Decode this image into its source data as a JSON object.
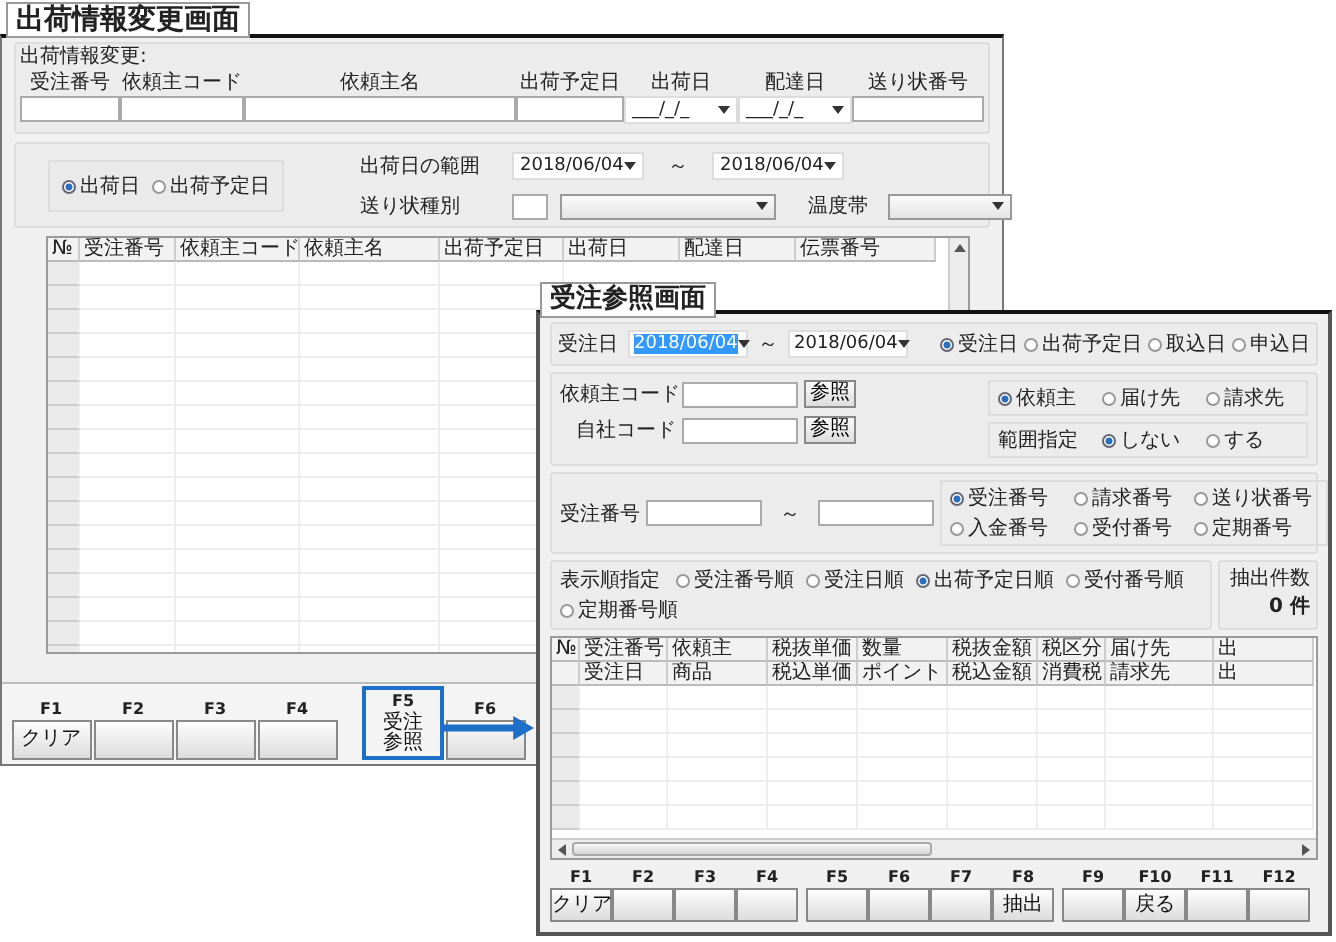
{
  "shipping_screen": {
    "title": "出荷情報変更画面",
    "group_label": "出荷情報変更:",
    "fields": [
      {
        "label": "受注番号",
        "kind": "text"
      },
      {
        "label": "依頼主コード",
        "kind": "text"
      },
      {
        "label": "依頼主名",
        "kind": "text"
      },
      {
        "label": "出荷予定日",
        "kind": "text"
      },
      {
        "label": "出荷日",
        "kind": "date",
        "value": "___/_/_"
      },
      {
        "label": "配達日",
        "kind": "date",
        "value": "___/_/_"
      },
      {
        "label": "送り状番号",
        "kind": "text"
      }
    ],
    "date_basis": [
      {
        "label": "出荷日",
        "selected": true
      },
      {
        "label": "出荷予定日",
        "selected": false
      }
    ],
    "range": {
      "label": "出荷日の範囲",
      "from": "2018/06/04",
      "separator": "～",
      "to": "2018/06/04"
    },
    "invoice_type_label": "送り状種別",
    "temperature_label": "温度帯",
    "table": {
      "columns": [
        "№",
        "受注番号",
        "依頼主コード",
        "依頼主名",
        "出荷予定日",
        "出荷日",
        "配達日",
        "伝票番号"
      ]
    },
    "function_keys": [
      {
        "key": "F1",
        "label": "クリア",
        "highlighted": false
      },
      {
        "key": "F2",
        "highlighted": false
      },
      {
        "key": "F3",
        "highlighted": false
      },
      {
        "key": "F4",
        "highlighted": false
      },
      {
        "key": "F5",
        "label": "受注参照",
        "highlighted": true
      },
      {
        "key": "F6",
        "highlighted": false
      }
    ]
  },
  "order_screen": {
    "title": "受注参照画面",
    "order_date": {
      "label": "受注日",
      "from": "2018/06/04",
      "from_focused": true,
      "separator": "～",
      "to": "2018/06/04"
    },
    "date_types": [
      {
        "label": "受注日",
        "selected": true
      },
      {
        "label": "出荷予定日",
        "selected": false
      },
      {
        "label": "取込日",
        "selected": false
      },
      {
        "label": "申込日",
        "selected": false
      }
    ],
    "codes": [
      {
        "label": "依頼主コード",
        "button": "参照"
      },
      {
        "label": "自社コード",
        "button": "参照"
      }
    ],
    "party_types": [
      {
        "label": "依頼主",
        "selected": true
      },
      {
        "label": "届け先",
        "selected": false
      },
      {
        "label": "請求先",
        "selected": false
      }
    ],
    "range_spec": {
      "label": "範囲指定",
      "options": [
        {
          "label": "しない",
          "selected": true
        },
        {
          "label": "する",
          "selected": false
        }
      ]
    },
    "order_number": {
      "label": "受注番号",
      "separator": "～"
    },
    "number_types": [
      {
        "label": "受注番号",
        "selected": true
      },
      {
        "label": "請求番号",
        "selected": false
      },
      {
        "label": "送り状番号",
        "selected": false
      },
      {
        "label": "入金番号",
        "selected": false
      },
      {
        "label": "受付番号",
        "selected": false
      },
      {
        "label": "定期番号",
        "selected": false
      }
    ],
    "sort": {
      "label": "表示順指定",
      "options": [
        {
          "label": "受注番号順",
          "selected": false
        },
        {
          "label": "受注日順",
          "selected": false
        },
        {
          "label": "出荷予定日順",
          "selected": true
        },
        {
          "label": "受付番号順",
          "selected": false
        },
        {
          "label": "定期番号順",
          "selected": false
        }
      ]
    },
    "extract_count": {
      "label": "抽出件数",
      "value": "0 件"
    },
    "table": {
      "columns": [
        {
          "top": "№"
        },
        {
          "top": "受注番号",
          "bottom": "受注日"
        },
        {
          "top": "依頼主",
          "bottom": "商品"
        },
        {
          "top": "税抜単価",
          "bottom": "税込単価"
        },
        {
          "top": "数量",
          "bottom": "ポイント"
        },
        {
          "top": "税抜金額",
          "bottom": "税込金額"
        },
        {
          "top": "税区分",
          "bottom": "消費税"
        },
        {
          "top": "届け先",
          "bottom": "請求先"
        },
        {
          "top": "出",
          "bottom": "出"
        }
      ]
    },
    "function_keys": [
      {
        "key": "F1",
        "label": "クリア"
      },
      {
        "key": "F2"
      },
      {
        "key": "F3"
      },
      {
        "key": "F4"
      },
      {
        "key": "F5"
      },
      {
        "key": "F6"
      },
      {
        "key": "F7"
      },
      {
        "key": "F8",
        "label": "抽出"
      },
      {
        "key": "F9"
      },
      {
        "key": "F10",
        "label": "戻る"
      },
      {
        "key": "F11"
      },
      {
        "key": "F12"
      }
    ]
  }
}
